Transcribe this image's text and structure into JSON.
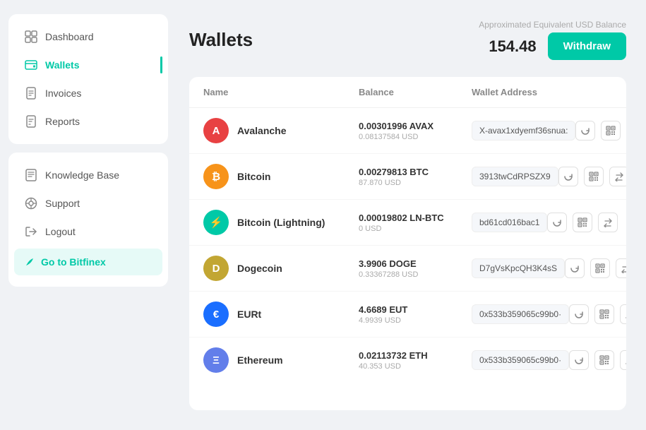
{
  "sidebar": {
    "card1": {
      "items": [
        {
          "id": "dashboard",
          "label": "Dashboard",
          "icon": "dashboard-icon",
          "active": false
        },
        {
          "id": "wallets",
          "label": "Wallets",
          "icon": "wallet-icon",
          "active": true
        },
        {
          "id": "invoices",
          "label": "Invoices",
          "icon": "invoices-icon",
          "active": false
        },
        {
          "id": "reports",
          "label": "Reports",
          "icon": "reports-icon",
          "active": false
        }
      ]
    },
    "card2": {
      "items": [
        {
          "id": "knowledge-base",
          "label": "Knowledge Base",
          "icon": "book-icon"
        },
        {
          "id": "support",
          "label": "Support",
          "icon": "support-icon"
        },
        {
          "id": "logout",
          "label": "Logout",
          "icon": "logout-icon"
        }
      ],
      "cta": {
        "label": "Go to Bitfinex",
        "icon": "leaf-icon"
      }
    }
  },
  "main": {
    "title": "Wallets",
    "approx_label": "Approximated Equivalent USD Balance",
    "balance": "154.48",
    "withdraw_label": "Withdraw",
    "table": {
      "headers": [
        "Name",
        "Balance",
        "Wallet Address"
      ],
      "rows": [
        {
          "id": "avalanche",
          "name": "Avalanche",
          "icon_color": "#E84142",
          "icon_text": "A",
          "balance_main": "0.00301996 AVAX",
          "balance_usd": "0.08137584 USD",
          "address": "X-avax1xdyemf36snua:"
        },
        {
          "id": "bitcoin",
          "name": "Bitcoin",
          "icon_color": "#F7931A",
          "icon_text": "₿",
          "balance_main": "0.00279813 BTC",
          "balance_usd": "87.870 USD",
          "address": "3913twCdRPSZX9"
        },
        {
          "id": "bitcoin-lightning",
          "name": "Bitcoin (Lightning)",
          "icon_color": "#00C9A7",
          "icon_text": "⚡",
          "balance_main": "0.00019802 LN-BTC",
          "balance_usd": "0 USD",
          "address": "bd61cd016bac1"
        },
        {
          "id": "dogecoin",
          "name": "Dogecoin",
          "icon_color": "#C2A633",
          "icon_text": "D",
          "balance_main": "3.9906 DOGE",
          "balance_usd": "0.33367288 USD",
          "address": "D7gVsKpcQH3K4sS"
        },
        {
          "id": "eurt",
          "name": "EURt",
          "icon_color": "#1A6EFF",
          "icon_text": "€",
          "balance_main": "4.6689 EUT",
          "balance_usd": "4.9939 USD",
          "address": "0x533b359065c99b0·"
        },
        {
          "id": "ethereum",
          "name": "Ethereum",
          "icon_color": "#627EEA",
          "icon_text": "Ξ",
          "balance_main": "0.02113732 ETH",
          "balance_usd": "40.353 USD",
          "address": "0x533b359065c99b0·"
        }
      ]
    }
  }
}
